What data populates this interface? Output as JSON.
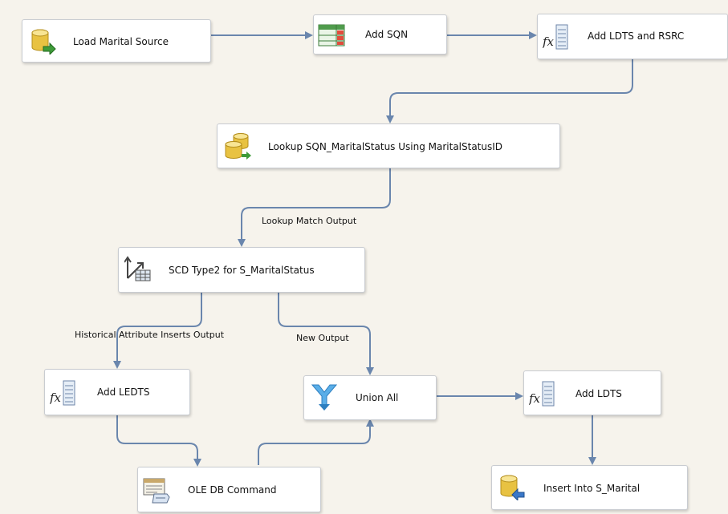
{
  "components": {
    "load_marital_source": {
      "label": "Load Marital Source",
      "icon": "database-source-icon"
    },
    "add_sqn": {
      "label": "Add SQN",
      "icon": "row-number-icon"
    },
    "add_ldts_rsrc": {
      "label": "Add LDTS and RSRC",
      "icon": "derived-column-icon"
    },
    "lookup_sqn": {
      "label": "Lookup SQN_MaritalStatus Using MaritalStatusID",
      "icon": "lookup-icon"
    },
    "scd_type2": {
      "label": "SCD Type2 for S_MaritalStatus",
      "icon": "slowly-changing-dimension-icon"
    },
    "add_ledts": {
      "label": "Add LEDTS",
      "icon": "derived-column-icon"
    },
    "union_all": {
      "label": "Union All",
      "icon": "union-all-icon"
    },
    "add_ldts": {
      "label": "Add LDTS",
      "icon": "derived-column-icon"
    },
    "ole_db_command": {
      "label": "OLE DB Command",
      "icon": "ole-db-command-icon"
    },
    "insert_s_marital": {
      "label": "Insert Into S_Marital",
      "icon": "database-destination-icon"
    }
  },
  "paths": {
    "lookup_match_output": "Lookup Match Output",
    "historical_attribute_inserts_output": "Historical Attribute Inserts Output",
    "new_output": "New Output"
  },
  "colors": {
    "canvas": "#f6f3ec",
    "arrow": "#6a86ad",
    "box_border": "#c9ccd1"
  }
}
